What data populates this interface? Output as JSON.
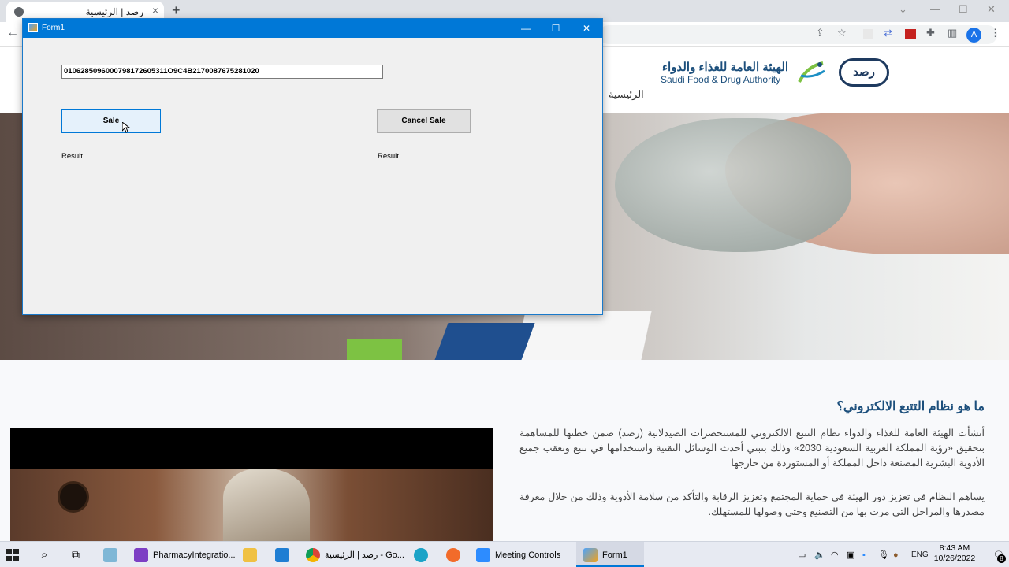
{
  "browser": {
    "tab_title": "رصد | الرئيسية",
    "new_tab": "+",
    "avatar_letter": "A"
  },
  "site": {
    "logo_arabic": "الهيئة العامة للغذاء والدواء",
    "logo_english": "Saudi Food & Drug Authority",
    "logo_rsd": "رصد",
    "nav_home": "الرئيسية",
    "section_title": "ما هو نظام التتبع الالكتروني؟",
    "paragraph_1": "أنشأت الهيئة العامة للغذاء والدواء نظام التتبع الالكتروني للمستحضرات الصيدلانية (رصد) ضمن خطتها للمساهمة بتحقيق «رؤية المملكة العربية السعودية 2030» وذلك بتبني أحدث الوسائل التقنية واستخدامها في تتبع وتعقب جميع الأدوية البشرية المصنعة داخل المملكة أو المستوردة من خارجها",
    "paragraph_2": "يساهم النظام في تعزيز دور الهيئة في حماية المجتمع وتعزيز الرقابة والتأكد من سلامة الأدوية وذلك من خلال معرفة مصدرها والمراحل التي مرت بها من التصنيع وحتى وصولها للمستهلك."
  },
  "form": {
    "title": "Form1",
    "minimize": "—",
    "maximize": "☐",
    "close": "✕",
    "barcode_value": "0106285096000798172605311O9C4B2170087675281020",
    "sale_label": "Sale",
    "cancel_sale_label": "Cancel Sale",
    "result_left": "Result",
    "result_right": "Result"
  },
  "taskbar": {
    "items": [
      {
        "label": "PharmacyIntegratio..."
      },
      {
        "label": "رصد | الرئيسية - Go..."
      },
      {
        "label": "Meeting Controls"
      },
      {
        "label": "Form1"
      }
    ],
    "language": "ENG",
    "time": "8:43 AM",
    "date": "10/26/2022",
    "notification_count": "8"
  }
}
